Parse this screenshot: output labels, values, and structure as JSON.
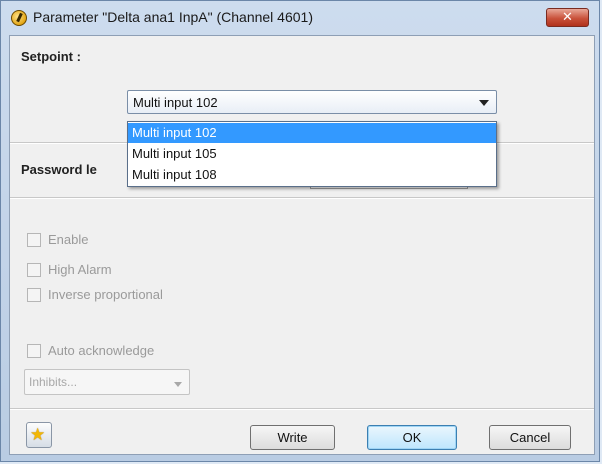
{
  "window": {
    "title": "Parameter \"Delta ana1 InpA\" (Channel 4601)",
    "close_label": "✕",
    "icon": "gauge-icon"
  },
  "setpoint": {
    "label": "Setpoint :",
    "selected": "Multi input 102",
    "options": [
      "Multi input 102",
      "Multi input 105",
      "Multi input 108"
    ]
  },
  "password": {
    "label": "Password le"
  },
  "checkboxes": {
    "enable": "Enable",
    "high_alarm": "High Alarm",
    "inverse_proportional": "Inverse proportional",
    "auto_acknowledge": "Auto acknowledge"
  },
  "inhibits": {
    "value": "Inhibits..."
  },
  "footer": {
    "favorite_icon": "star-icon",
    "write_label": "Write",
    "ok_label": "OK",
    "cancel_label": "Cancel"
  },
  "colors": {
    "selection": "#3399ff",
    "close_button": "#c9523b"
  }
}
